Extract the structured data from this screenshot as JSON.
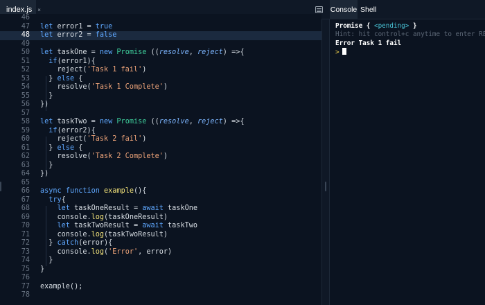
{
  "editor_tab": {
    "label": "index.js",
    "close": "×"
  },
  "console_tabs": {
    "console": "Console",
    "shell": "Shell"
  },
  "icons": {
    "layout": "panel-layout-icon",
    "close": "close-icon"
  },
  "line_numbers": [
    "46",
    "47",
    "48",
    "49",
    "50",
    "51",
    "52",
    "53",
    "54",
    "55",
    "56",
    "57",
    "58",
    "59",
    "60",
    "61",
    "62",
    "63",
    "64",
    "65",
    "66",
    "67",
    "68",
    "69",
    "70",
    "71",
    "72",
    "73",
    "74",
    "75",
    "76",
    "77",
    "78"
  ],
  "active_line": "48",
  "code_lines": [
    [],
    [
      [
        "kw",
        "let"
      ],
      [
        "t",
        " error1 = "
      ],
      [
        "kw",
        "true"
      ]
    ],
    [
      [
        "kw",
        "let"
      ],
      [
        "t",
        " error2 = "
      ],
      [
        "kw",
        "false"
      ]
    ],
    [],
    [
      [
        "kw",
        "let"
      ],
      [
        "t",
        " taskOne = "
      ],
      [
        "kw",
        "new"
      ],
      [
        "t",
        " "
      ],
      [
        "cls",
        "Promise"
      ],
      [
        "t",
        " (("
      ],
      [
        "prm",
        "resolve"
      ],
      [
        "t",
        ", "
      ],
      [
        "prm",
        "reject"
      ],
      [
        "t",
        ") =>{"
      ]
    ],
    [
      [
        "t",
        "  "
      ],
      [
        "kw",
        "if"
      ],
      [
        "t",
        "(error1){"
      ]
    ],
    [
      [
        "t",
        "    reject("
      ],
      [
        "str",
        "'Task 1 fail'"
      ],
      [
        "t",
        ")"
      ]
    ],
    [
      [
        "t",
        "  } "
      ],
      [
        "kw",
        "else"
      ],
      [
        "t",
        " {"
      ]
    ],
    [
      [
        "t",
        "    resolve("
      ],
      [
        "str",
        "'Task 1 Complete'"
      ],
      [
        "t",
        ")"
      ]
    ],
    [
      [
        "t",
        "  }"
      ]
    ],
    [
      [
        "t",
        "})"
      ]
    ],
    [],
    [
      [
        "kw",
        "let"
      ],
      [
        "t",
        " taskTwo = "
      ],
      [
        "kw",
        "new"
      ],
      [
        "t",
        " "
      ],
      [
        "cls",
        "Promise"
      ],
      [
        "t",
        " (("
      ],
      [
        "prm",
        "resolve"
      ],
      [
        "t",
        ", "
      ],
      [
        "prm",
        "reject"
      ],
      [
        "t",
        ") =>{"
      ]
    ],
    [
      [
        "t",
        "  "
      ],
      [
        "kw",
        "if"
      ],
      [
        "t",
        "(error2){"
      ]
    ],
    [
      [
        "t",
        "    reject("
      ],
      [
        "str",
        "'Task 2 fail'"
      ],
      [
        "t",
        ")"
      ]
    ],
    [
      [
        "t",
        "  } "
      ],
      [
        "kw",
        "else"
      ],
      [
        "t",
        " {"
      ]
    ],
    [
      [
        "t",
        "    resolve("
      ],
      [
        "str",
        "'Task 2 Complete'"
      ],
      [
        "t",
        ")"
      ]
    ],
    [
      [
        "t",
        "  }"
      ]
    ],
    [
      [
        "t",
        "})"
      ]
    ],
    [],
    [
      [
        "kw",
        "async"
      ],
      [
        "t",
        " "
      ],
      [
        "kw",
        "function"
      ],
      [
        "t",
        " "
      ],
      [
        "fn",
        "example"
      ],
      [
        "t",
        "(){"
      ]
    ],
    [
      [
        "t",
        "  "
      ],
      [
        "kw",
        "try"
      ],
      [
        "t",
        "{"
      ]
    ],
    [
      [
        "t",
        "    "
      ],
      [
        "kw",
        "let"
      ],
      [
        "t",
        " taskOneResult = "
      ],
      [
        "kw",
        "await"
      ],
      [
        "t",
        " taskOne"
      ]
    ],
    [
      [
        "t",
        "    console."
      ],
      [
        "fn",
        "log"
      ],
      [
        "t",
        "(taskOneResult)"
      ]
    ],
    [
      [
        "t",
        "    "
      ],
      [
        "kw",
        "let"
      ],
      [
        "t",
        " taskTwoResult = "
      ],
      [
        "kw",
        "await"
      ],
      [
        "t",
        " taskTwo"
      ]
    ],
    [
      [
        "t",
        "    console."
      ],
      [
        "fn",
        "log"
      ],
      [
        "t",
        "(taskTwoResult)"
      ]
    ],
    [
      [
        "t",
        "  } "
      ],
      [
        "kw",
        "catch"
      ],
      [
        "t",
        "(error){"
      ]
    ],
    [
      [
        "t",
        "    console."
      ],
      [
        "fn",
        "log"
      ],
      [
        "t",
        "("
      ],
      [
        "str",
        "'Error'"
      ],
      [
        "t",
        ", error)"
      ]
    ],
    [
      [
        "t",
        "  }"
      ]
    ],
    [
      [
        "t",
        "}"
      ]
    ],
    [],
    [
      [
        "t",
        "example();"
      ]
    ],
    []
  ],
  "console_output": {
    "promise_prefix": "Promise { ",
    "pending": "<pending>",
    "promise_suffix": " }",
    "hint": "Hint: hit control+c anytime to enter REPL.",
    "error": "Error Task 1 fail",
    "prompt": ">"
  },
  "colors": {
    "keyword": "#5fa8ff",
    "string": "#f0a57a",
    "class": "#3fcf9c",
    "function": "#f2e27a",
    "background": "#0b1320"
  }
}
